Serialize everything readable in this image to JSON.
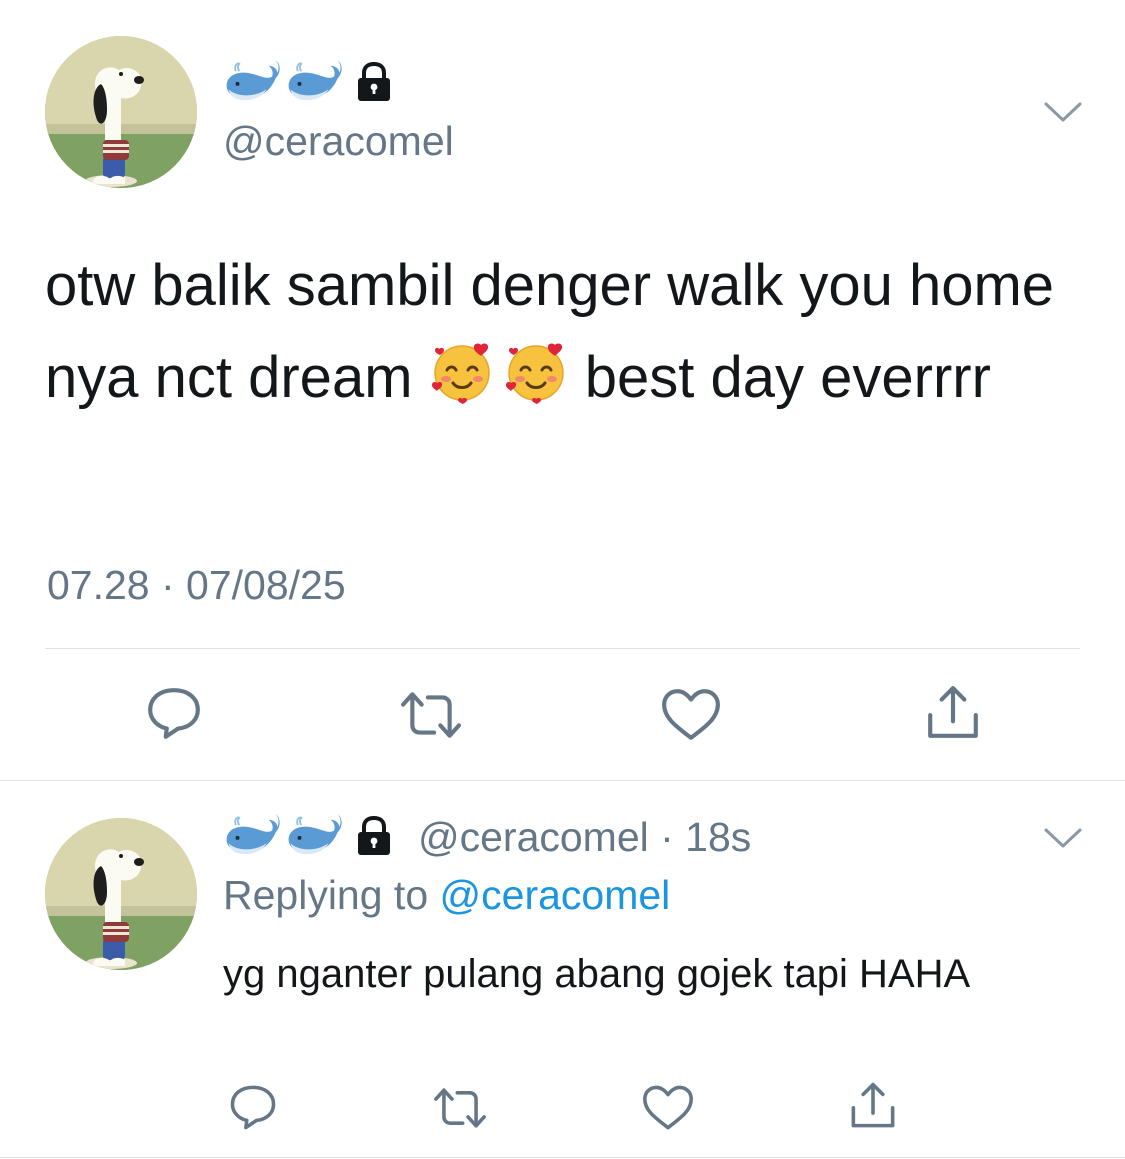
{
  "main_tweet": {
    "handle": "@ceracomel",
    "name_icons": [
      "whale-emoji",
      "whale-emoji",
      "lock-icon"
    ],
    "text_part1": "otw balik sambil denger walk you home nya nct dream ",
    "text_part2": " best day everrrr",
    "emojis": [
      "smiling-face-with-hearts",
      "smiling-face-with-hearts"
    ],
    "timestamp": "07.28 · 07/08/25",
    "actions": [
      "reply-icon",
      "retweet-icon",
      "like-icon",
      "share-icon"
    ]
  },
  "reply_tweet": {
    "handle_meta": "@ceracomel · 18s",
    "replying_prefix": "Replying to ",
    "replying_mention": "@ceracomel",
    "text": "yg nganter pulang abang gojek tapi HAHA",
    "actions": [
      "reply-icon",
      "retweet-icon",
      "like-icon",
      "share-icon"
    ]
  },
  "colors": {
    "text": "#14171a",
    "secondary": "#657786",
    "link": "#1b95e0",
    "divider": "#dfe3e6"
  }
}
